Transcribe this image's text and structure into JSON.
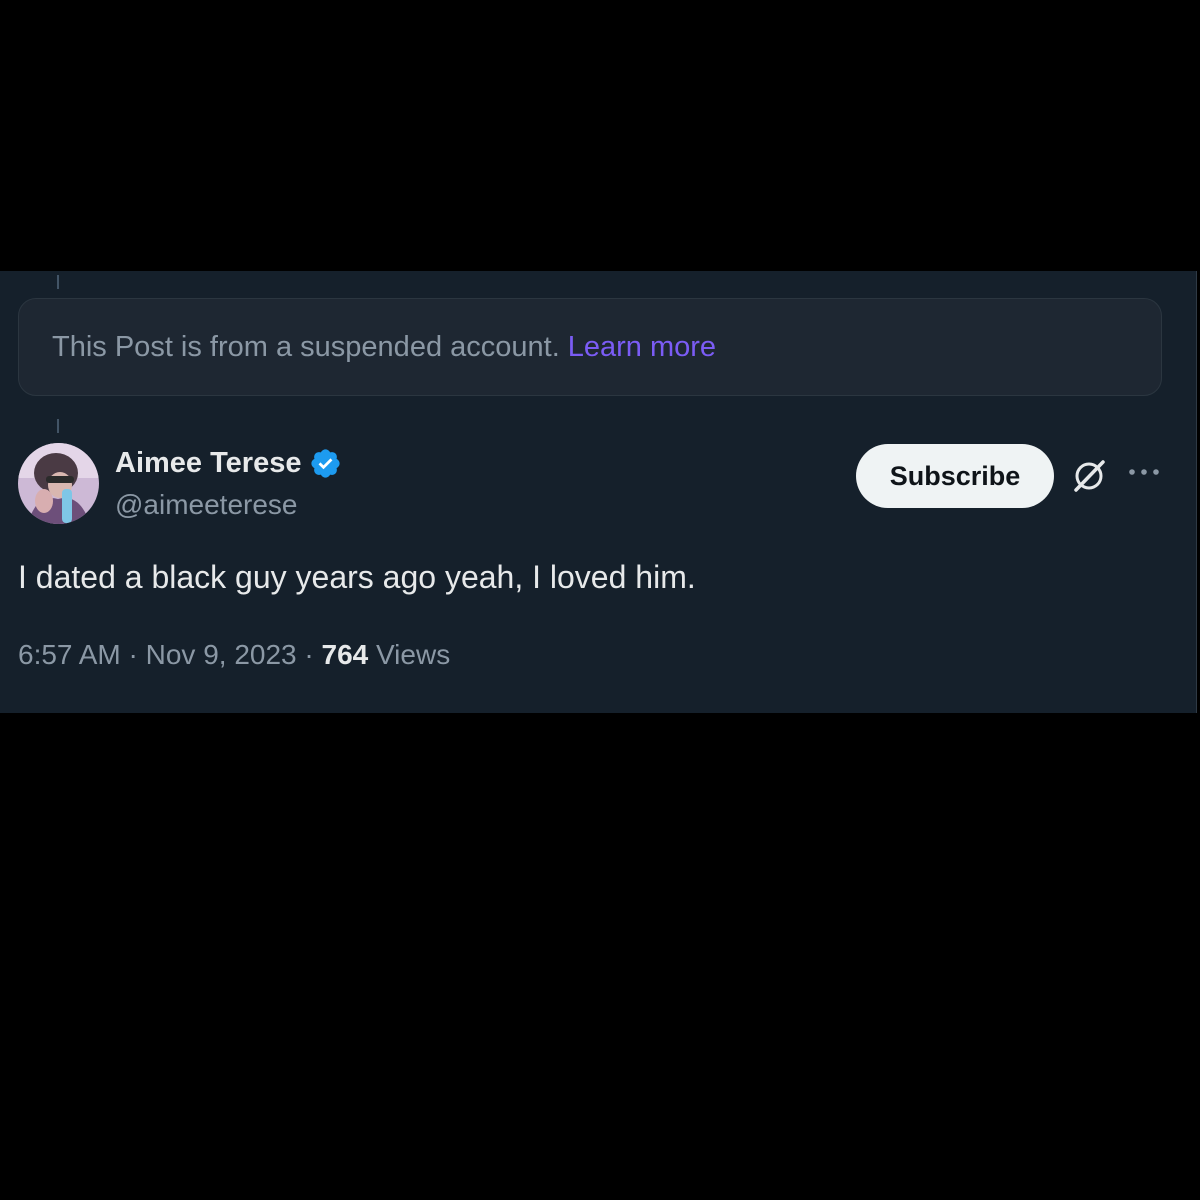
{
  "suspended_notice": {
    "text": "This Post is from a suspended account.",
    "link_label": "Learn more"
  },
  "author": {
    "display_name": "Aimee Terese",
    "handle": "@aimeeterese",
    "verified": true,
    "avatar_icon": "profile-photo"
  },
  "actions": {
    "subscribe_label": "Subscribe",
    "grok_icon": "grok-icon",
    "more_icon": "more-dots-icon"
  },
  "tweet": {
    "text": "I dated a black guy years ago yeah, I loved him."
  },
  "meta": {
    "time": "6:57 AM",
    "separator": " · ",
    "date": "Nov 9, 2023",
    "views_count": "764",
    "views_label": "Views"
  },
  "colors": {
    "background": "#15202b",
    "link": "#7b5cf5",
    "verified": "#1d9bf0",
    "primary_text": "#e7e9ea",
    "secondary_text": "#8b98a5"
  }
}
